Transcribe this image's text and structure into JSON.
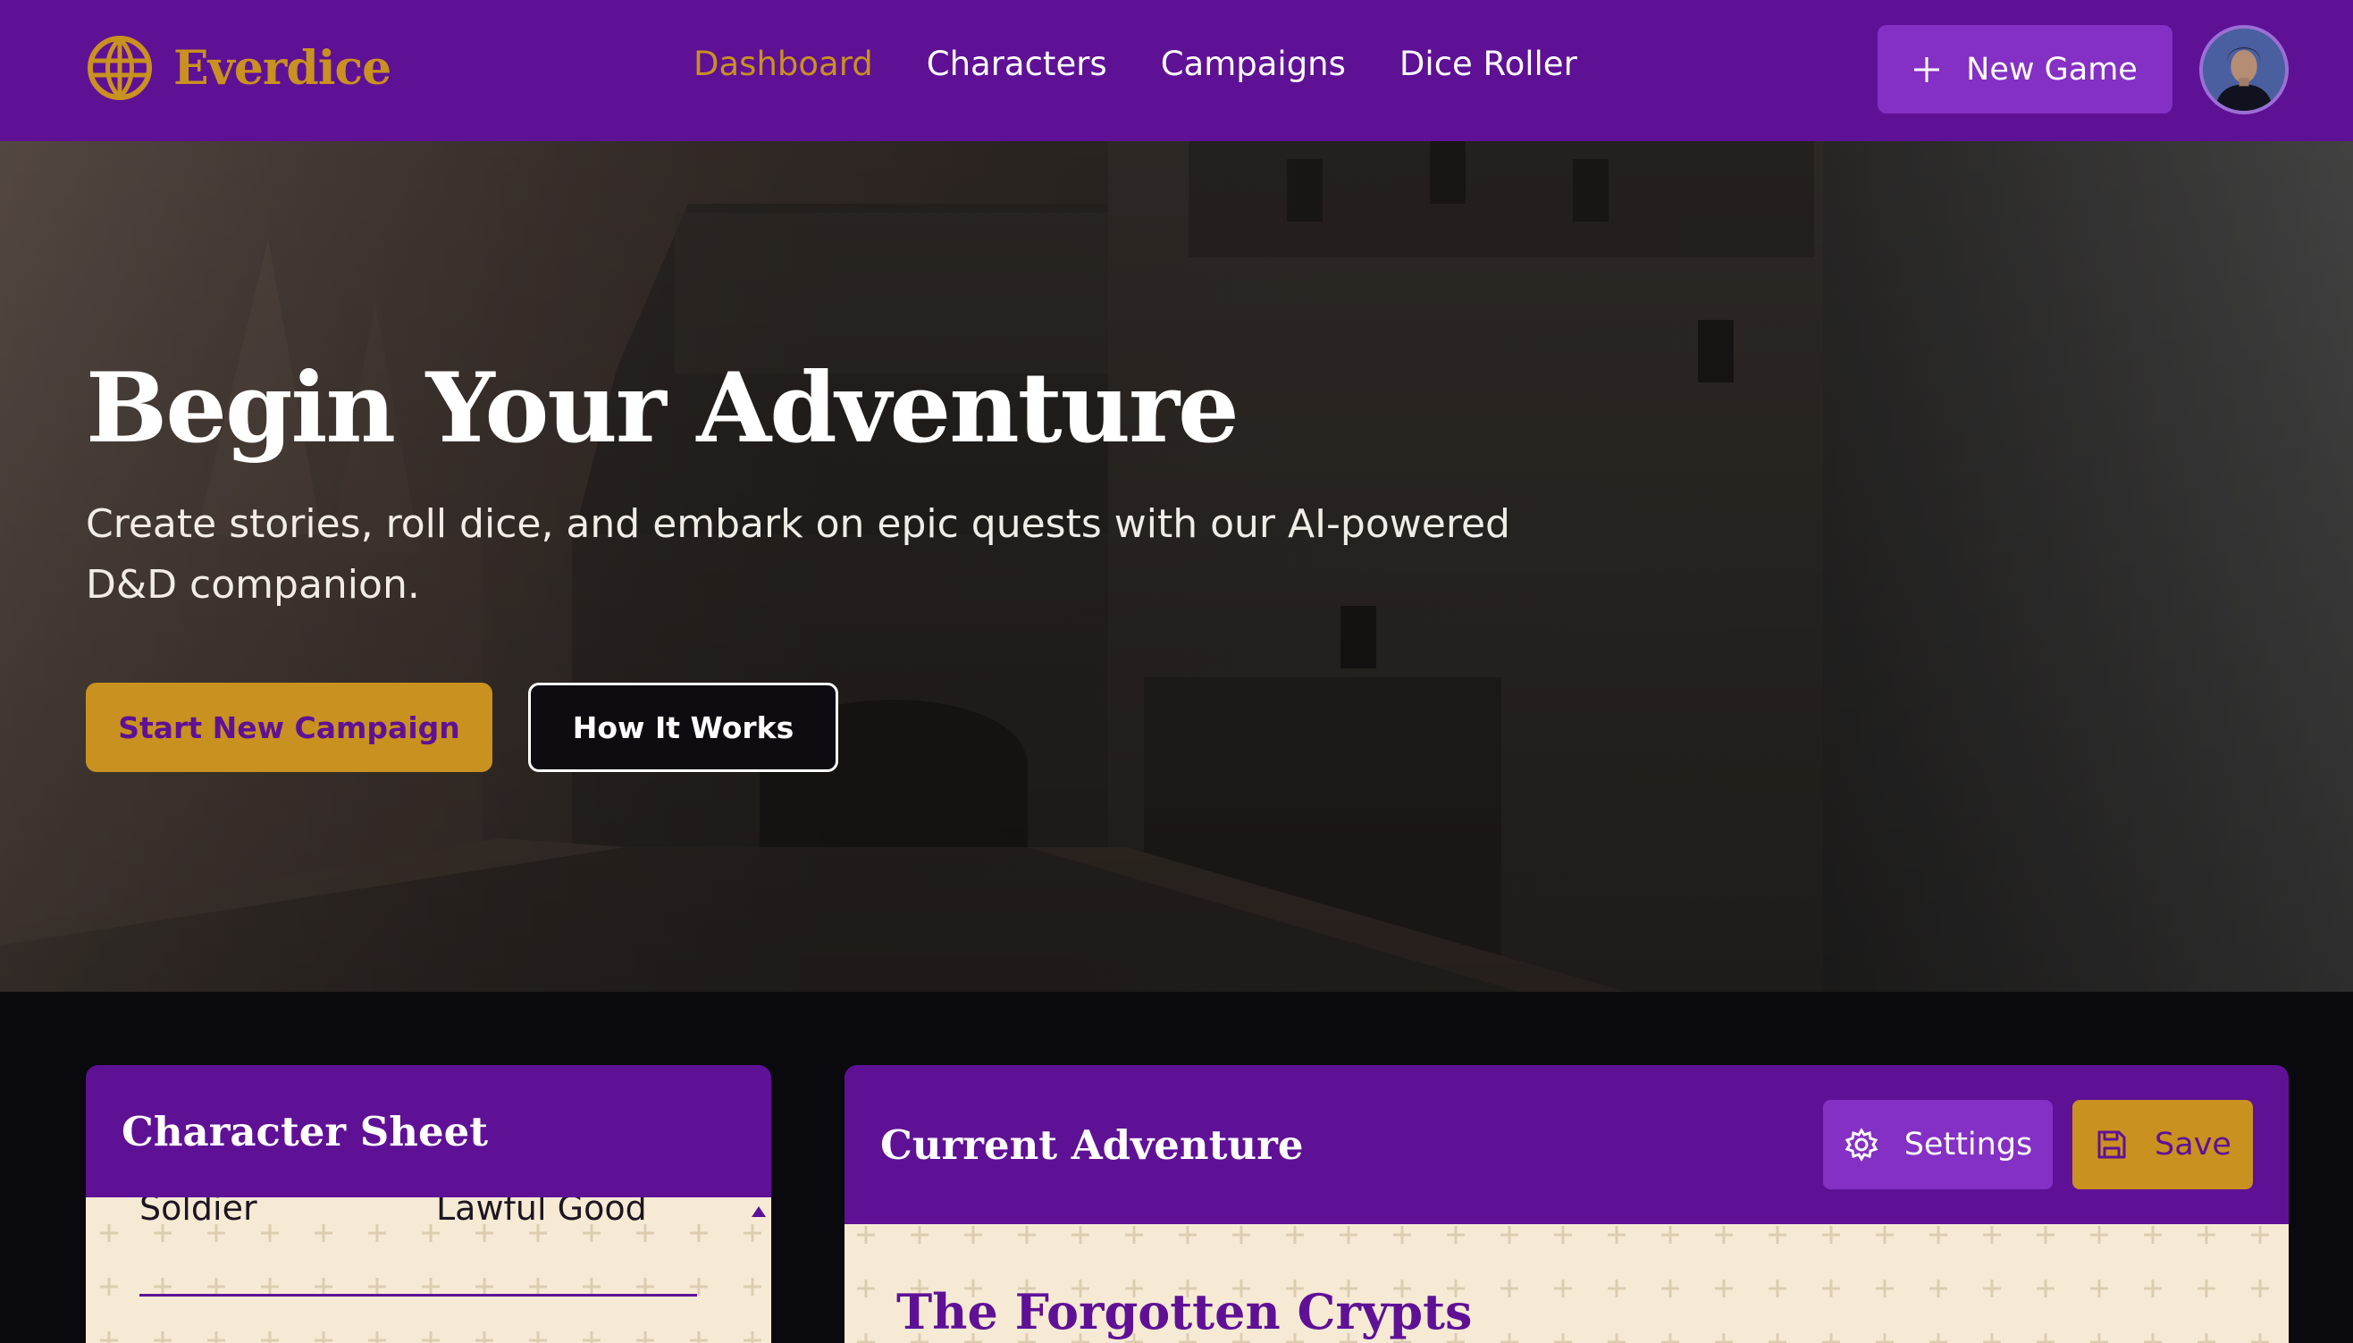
{
  "app": {
    "brand_name": "Everdice",
    "brand_icon": "globe-icon",
    "colors": {
      "purple": "#5f1196",
      "gold": "#c9911f",
      "parchment": "#f6ead5",
      "violet": "#8530c4"
    }
  },
  "nav": {
    "items": [
      {
        "label": "Dashboard",
        "active": true
      },
      {
        "label": "Characters",
        "active": false
      },
      {
        "label": "Campaigns",
        "active": false
      },
      {
        "label": "Dice Roller",
        "active": false
      }
    ],
    "new_game": {
      "label": "New Game",
      "icon": "plus-icon"
    },
    "avatar": "user-avatar"
  },
  "hero": {
    "title": "Begin Your Adventure",
    "subtitle": "Create stories, roll dice, and embark on epic quests with our AI-powered D&D companion.",
    "primary_button": "Start New Campaign",
    "secondary_button": "How It Works"
  },
  "character_sheet": {
    "title": "Character Sheet",
    "background": "Soldier",
    "alignment": "Lawful Good"
  },
  "adventure": {
    "title": "Current Adventure",
    "settings_label": "Settings",
    "save_label": "Save",
    "name": "The Forgotten Crypts"
  }
}
